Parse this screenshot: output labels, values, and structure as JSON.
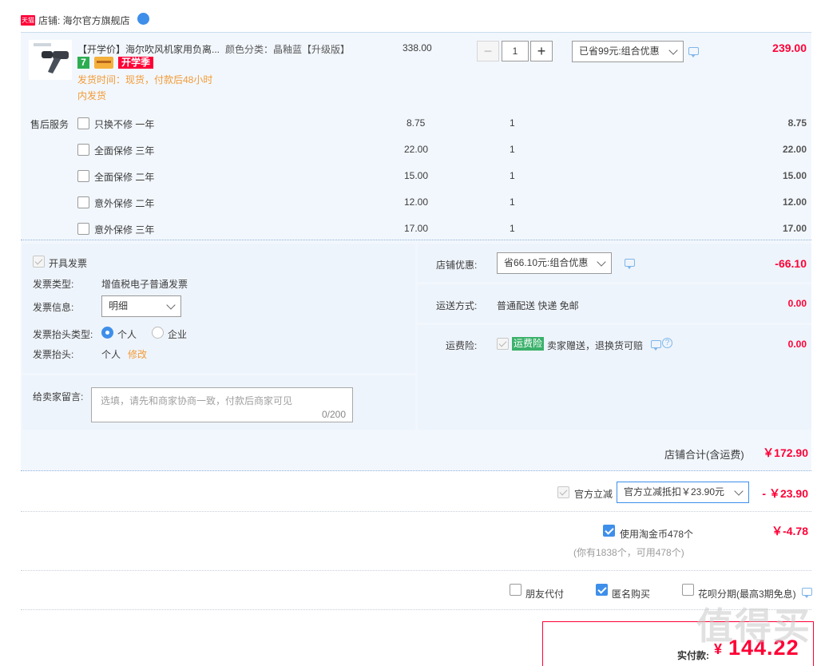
{
  "shop": {
    "badge": "天猫",
    "label": "店铺: 海尔官方旗舰店"
  },
  "item": {
    "title": "【开学价】海尔吹风机家用负离...",
    "sku": "颜色分类：晶釉蓝【升级版】",
    "price": "338.00",
    "quantity": "1",
    "promo_select": "已省99元:组合优惠",
    "subtotal": "239.00",
    "tag_seven": "7",
    "tag_school": "开学季",
    "ship_time_line1": "发货时间：现货，付款后48小时",
    "ship_time_line2": "内发货"
  },
  "service": {
    "label": "售后服务",
    "options": [
      {
        "name": "只换不修 一年",
        "price": "8.75",
        "qty": "1",
        "total": "8.75"
      },
      {
        "name": "全面保修 三年",
        "price": "22.00",
        "qty": "1",
        "total": "22.00"
      },
      {
        "name": "全面保修 二年",
        "price": "15.00",
        "qty": "1",
        "total": "15.00"
      },
      {
        "name": "意外保修 二年",
        "price": "12.00",
        "qty": "1",
        "total": "12.00"
      },
      {
        "name": "意外保修 三年",
        "price": "17.00",
        "qty": "1",
        "total": "17.00"
      }
    ]
  },
  "invoice": {
    "open_label": "开具发票",
    "type_label": "发票类型:",
    "type_value": "增值税电子普通发票",
    "info_label": "发票信息:",
    "info_value": "明细",
    "head_type_label": "发票抬头类型:",
    "head_personal": "个人",
    "head_company": "企业",
    "head_label": "发票抬头:",
    "head_value": "个人",
    "modify": "修改"
  },
  "message": {
    "label": "给卖家留言:",
    "placeholder": "选填，请先和商家协商一致，付款后商家可见",
    "counter": "0/200"
  },
  "shop_discount": {
    "label": "店铺优惠:",
    "select": "省66.10元:组合优惠",
    "amount": "-66.10"
  },
  "shipping": {
    "label": "运送方式:",
    "value": "普通配送 快递 免邮",
    "amount": "0.00"
  },
  "freight_insurance": {
    "label": "运费险:",
    "tag": "运费险",
    "text": "卖家赠送，退换货可赔",
    "amount": "0.00"
  },
  "shop_total": {
    "label": "店铺合计(含运费)",
    "amount": "￥172.90"
  },
  "official": {
    "label": "官方立减",
    "select": "官方立减抵扣￥23.90元",
    "amount": "- ￥23.90"
  },
  "taojinbi": {
    "label": "使用淘金币478个",
    "note": "(你有1838个，可用478个)",
    "amount": "￥-4.78"
  },
  "options": {
    "friend_pay": "朋友代付",
    "anonymous": "匿名购买",
    "huabei": "花呗分期(最高3期免息)"
  },
  "pay": {
    "label": "实付款:",
    "amount": "144.22"
  },
  "watermark": "值得买",
  "colors": {
    "accent": "#3e8fea",
    "price_red": "#ff0036",
    "orange": "#f39b36",
    "panel_bg": "#f2f7fd"
  }
}
